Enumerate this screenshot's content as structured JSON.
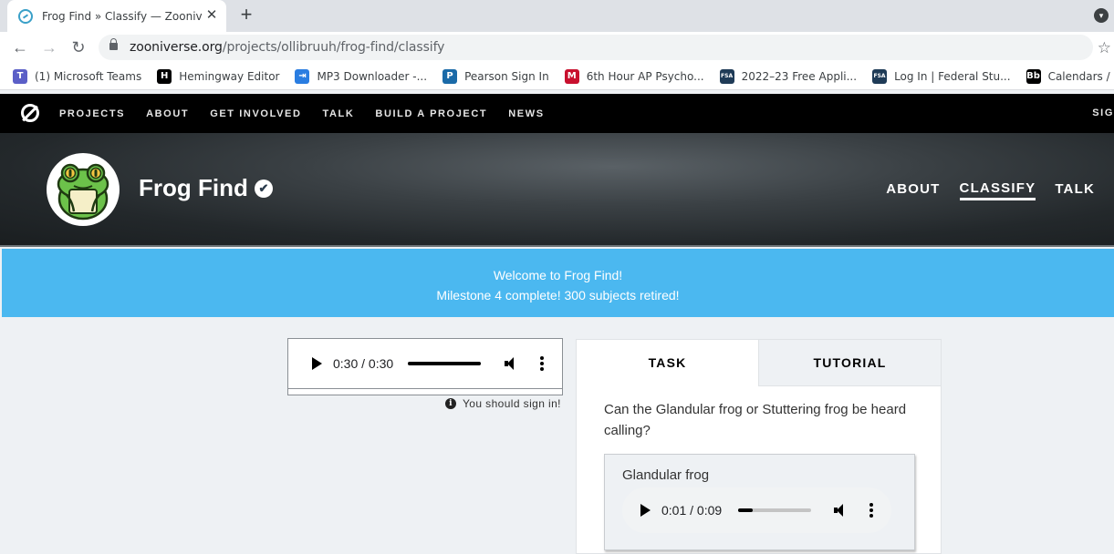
{
  "browser": {
    "tab_title": "Frog Find » Classify — Zooniverse",
    "url_host": "zooniverse.org",
    "url_path": "/projects/ollibruuh/frog-find/classify",
    "bookmarks": [
      {
        "label": "(1) Microsoft Teams",
        "icon": "teams-icon",
        "color": "#5b5fc7"
      },
      {
        "label": "Hemingway Editor",
        "icon": "hemingway-icon",
        "color": "#000000"
      },
      {
        "label": "MP3 Downloader -...",
        "icon": "mp3-icon",
        "color": "#2a7de1"
      },
      {
        "label": "Pearson Sign In",
        "icon": "pearson-icon",
        "color": "#1a6aa8"
      },
      {
        "label": "6th Hour AP Psycho...",
        "icon": "psych-icon",
        "color": "#c8102e"
      },
      {
        "label": "2022–23 Free Appli...",
        "icon": "fsa-icon",
        "color": "#1f3b57"
      },
      {
        "label": "Log In | Federal Stu...",
        "icon": "fsa-icon",
        "color": "#1f3b57"
      },
      {
        "label": "Calendars / Bell Sch...",
        "icon": "blackboard-icon",
        "color": "#000000"
      }
    ],
    "bookmark_glyphs": [
      "T",
      "H",
      "⇥",
      "P",
      "M",
      "FSA",
      "FSA",
      "Bb"
    ]
  },
  "sitenav": {
    "links": [
      "PROJECTS",
      "ABOUT",
      "GET INVOLVED",
      "TALK",
      "BUILD A PROJECT",
      "NEWS"
    ],
    "signin": "SIG"
  },
  "project": {
    "title": "Frog Find",
    "verified_glyph": "✔",
    "nav": [
      "ABOUT",
      "CLASSIFY",
      "TALK"
    ],
    "active_nav": "CLASSIFY"
  },
  "banner": {
    "line1": "Welcome to Frog Find!",
    "line2": "Milestone 4 complete! 300 subjects retired!"
  },
  "subject_player": {
    "time": "0:30 / 0:30",
    "progress": 1.0
  },
  "signin_note": "You should sign in!",
  "task": {
    "tabs": [
      "TASK",
      "TUTORIAL"
    ],
    "question": "Can the Glandular frog or Stuttering frog be heard calling?",
    "answer_label": "Glandular frog",
    "answer_player": {
      "time": "0:01 / 0:09",
      "progress": 0.2
    }
  },
  "colors": {
    "banner": "#4bb8f0",
    "nav_bg": "#000000",
    "frog_green": "#6cc24a"
  }
}
